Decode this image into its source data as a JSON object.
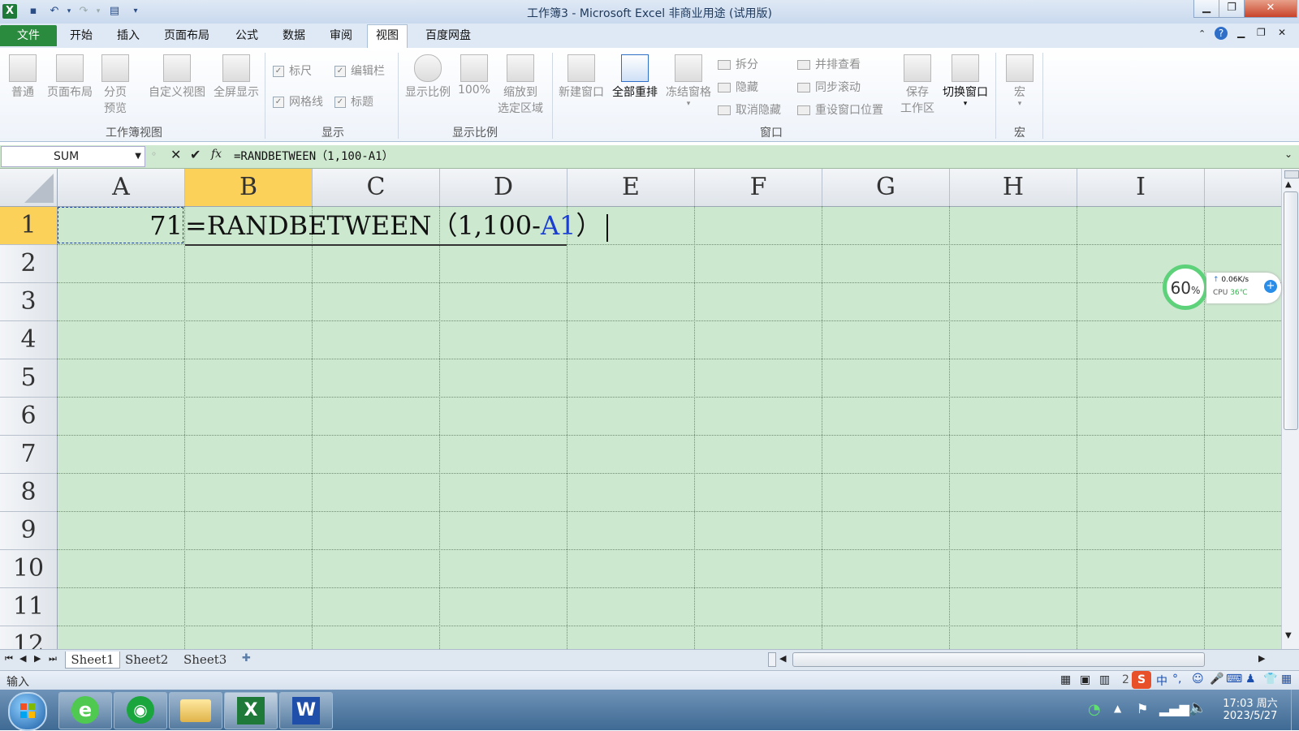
{
  "window": {
    "title": "工作簿3 - Microsoft Excel 非商业用途 (试用版)"
  },
  "tabs": [
    "文件",
    "开始",
    "插入",
    "页面布局",
    "公式",
    "数据",
    "审阅",
    "视图",
    "百度网盘"
  ],
  "ribbon": {
    "workbook_views": {
      "normal": "普通",
      "page_layout": "页面布局",
      "page_break_l1": "分页",
      "page_break_l2": "预览",
      "custom_views": "自定义视图",
      "full_screen": "全屏显示",
      "group": "工作簿视图"
    },
    "show": {
      "ruler": "标尺",
      "formula_bar": "编辑栏",
      "gridlines": "网格线",
      "headings": "标题",
      "group": "显示"
    },
    "zoom": {
      "zoom": "显示比例",
      "hundred": "100%",
      "zoom_sel_l1": "缩放到",
      "zoom_sel_l2": "选定区域",
      "group": "显示比例"
    },
    "window": {
      "new_window": "新建窗口",
      "arrange_all": "全部重排",
      "freeze": "冻结窗格",
      "split": "拆分",
      "hide": "隐藏",
      "unhide": "取消隐藏",
      "side_by_side": "并排查看",
      "sync_scroll": "同步滚动",
      "reset_pos": "重设窗口位置",
      "save_ws_l1": "保存",
      "save_ws_l2": "工作区",
      "switch": "切换窗口",
      "group": "窗口"
    },
    "macros": {
      "macro": "宏",
      "group": "宏"
    }
  },
  "formula_bar": {
    "name_box": "SUM",
    "formula": "=RANDBETWEEN（1,100-A1）"
  },
  "sheet": {
    "columns": [
      "A",
      "B",
      "C",
      "D",
      "E",
      "F",
      "G",
      "H",
      "I"
    ],
    "rows": [
      "1",
      "2",
      "3",
      "4",
      "5",
      "6",
      "7",
      "8",
      "9",
      "10",
      "11",
      "12"
    ],
    "a1_value": "71",
    "b1_prefix": "=RANDBETWEEN（1,100-",
    "b1_ref": "A1",
    "b1_suffix": "）"
  },
  "sheet_tabs": [
    "Sheet1",
    "Sheet2",
    "Sheet3"
  ],
  "status": {
    "mode": "输入",
    "zoom_partial": "2"
  },
  "widget": {
    "cpu_percent": "60",
    "percent_sign": "%",
    "net_speed": "0.06K/s",
    "cpu_label": "CPU",
    "cpu_temp": "36℃"
  },
  "clock": {
    "time": "17:03 周六",
    "date": "2023/5/27"
  }
}
